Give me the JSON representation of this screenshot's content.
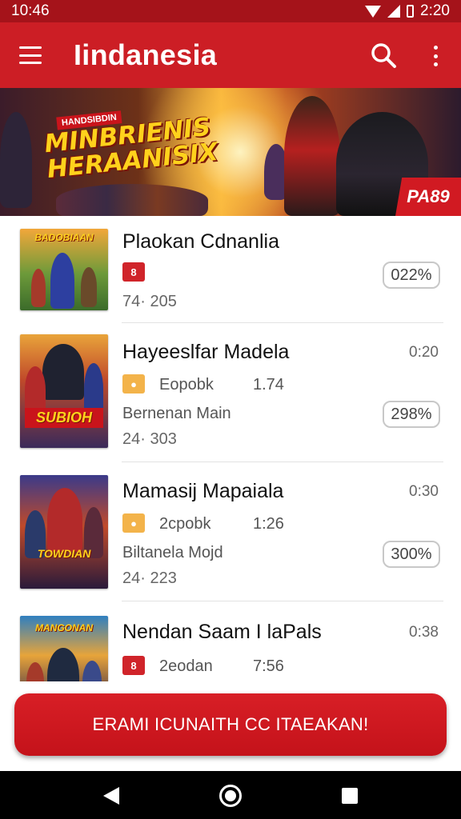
{
  "status_bar": {
    "time": "10:46",
    "right_time": "2:20"
  },
  "app_bar": {
    "title": "Iindanesia"
  },
  "banner": {
    "subtitle": "HANDSIBDIN",
    "title_line1": "MINBRIENIS",
    "title_line2": "HERAANISIX",
    "badge": "PA89"
  },
  "items": [
    {
      "thumb_label": "BADOBIAAN",
      "name": "Plaokan Cdnanlia",
      "tag_glyph": "8",
      "tag_color": "red",
      "meta": "74· 205",
      "pill": "022%"
    },
    {
      "thumb_label": "SUBIOH",
      "name": "Hayeeslfar Madela",
      "time": "0:20",
      "tag_glyph": "●",
      "tag_color": "orange",
      "tag_text": "Eopobk",
      "size": "1.74",
      "sub": "Bernenan Main",
      "meta": "24· 303",
      "pill": "298%"
    },
    {
      "thumb_label": "TOWDIAN",
      "name": "Mamasij Mapaiala",
      "time": "0:30",
      "tag_glyph": "●",
      "tag_color": "orange",
      "tag_text": "2cpobk",
      "size": "1:26",
      "sub": "Biltanela Mojd",
      "meta": "24· 223",
      "pill": "300%"
    },
    {
      "thumb_label": "MANGONAN",
      "name": "Nendan Saam I laPals",
      "time": "0:38",
      "tag_glyph": "8",
      "tag_color": "red",
      "tag_text": "2eodan",
      "size": "7:56"
    }
  ],
  "cta": {
    "label": "ERAMI ICUNAITH CC ITAEAKAN!"
  },
  "nav": {
    "back": "back-icon",
    "home": "home-icon",
    "recent": "recent-apps-icon"
  },
  "colors": {
    "brand": "#cc1e25",
    "status": "#a5131a",
    "accent_orange": "#f3b34a"
  }
}
